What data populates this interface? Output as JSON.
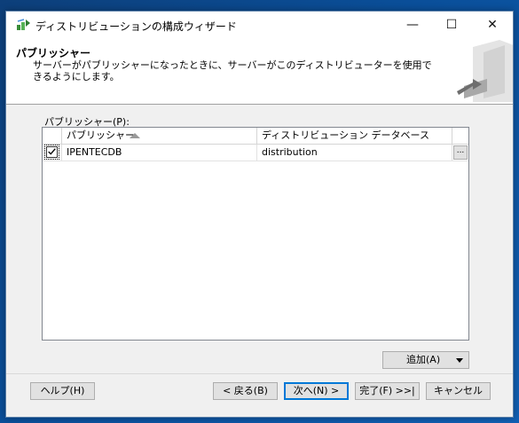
{
  "window": {
    "title": "ディストリビューションの構成ウィザード",
    "min_glyph": "—",
    "max_glyph": "☐",
    "close_glyph": "✕"
  },
  "header": {
    "title": "パブリッシャー",
    "description": "サーバーがパブリッシャーになったときに、サーバーがこのディストリビューターを使用できるようにします。"
  },
  "publishers_section": {
    "label": "パブリッシャー(P):",
    "columns": {
      "publisher": "パブリッシャー",
      "database": "ディストリビューション データベース"
    },
    "sort": "ascending",
    "rows": [
      {
        "checked": true,
        "publisher": "IPENTECDB",
        "database": "distribution",
        "ellipsis": "..."
      }
    ]
  },
  "add_button": {
    "label": "追加(A)"
  },
  "footer": {
    "help": "ヘルプ(H)",
    "back": "< 戻る(B)",
    "next": "次へ(N) >",
    "finish": "完了(F) >>|",
    "cancel": "キャンセル"
  },
  "colors": {
    "accent": "#0078d7",
    "desktop": "#0a4f9a",
    "dialog_bg": "#f0f0f0"
  }
}
